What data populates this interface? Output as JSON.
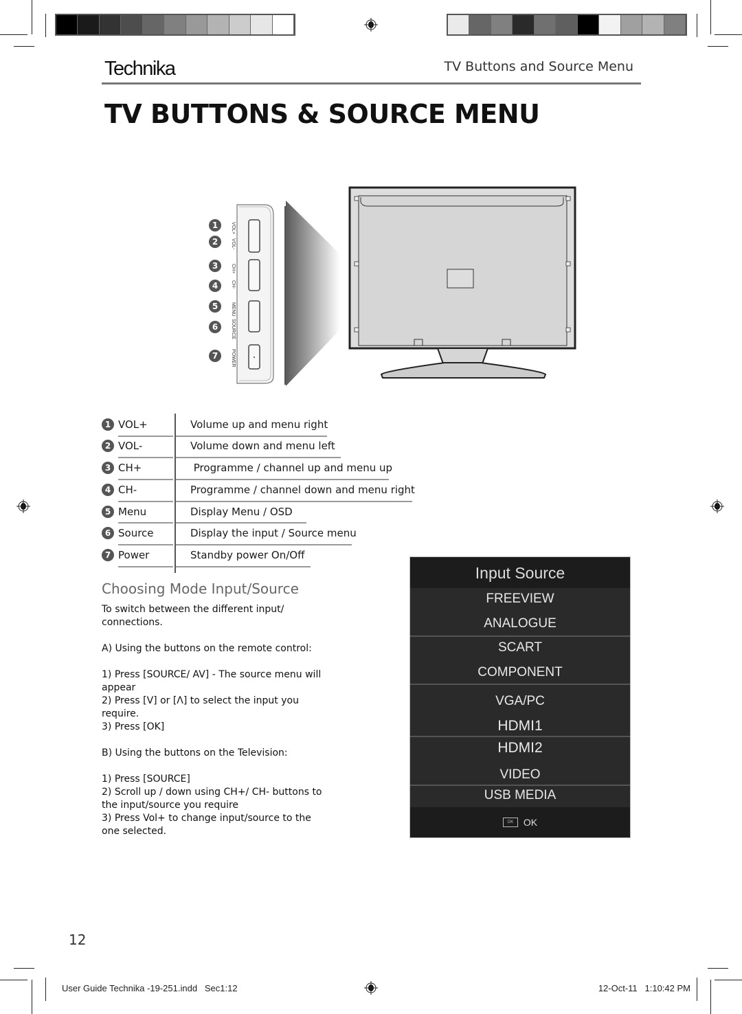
{
  "header": {
    "brand": "Technika",
    "section_title": "TV Buttons and Source Menu",
    "page_title": "TV BUTTONS & SOURCE MENU"
  },
  "calibration": {
    "left_bar": [
      "#000000",
      "#1a1a1a",
      "#333333",
      "#4d4d4d",
      "#666666",
      "#808080",
      "#999999",
      "#b3b3b3",
      "#cccccc",
      "#e6e6e6",
      "#ffffff"
    ],
    "right_bar": [
      "#eaeaea",
      "#666666",
      "#808080",
      "#2a2a2a",
      "#707070",
      "#5f5f5f",
      "#000000",
      "#f2f2f2",
      "#a0a0a0",
      "#b3b3b3",
      "#808080"
    ]
  },
  "side_panel": {
    "numbers": [
      "1",
      "2",
      "3",
      "4",
      "5",
      "6",
      "7"
    ],
    "labels": [
      "VOL+",
      "VOL-",
      "CH+",
      "CH-",
      "MENU",
      "SOURCE",
      "POWER"
    ]
  },
  "buttons_table": [
    {
      "num": "1",
      "key": "VOL+",
      "description": "Volume up and menu right"
    },
    {
      "num": "2",
      "key": "VOL-",
      "description": "Volume down and menu left"
    },
    {
      "num": "3",
      "key": "CH+",
      "description": " Programme / channel up and menu up"
    },
    {
      "num": "4",
      "key": "CH-",
      "description": "Programme / channel down and menu right"
    },
    {
      "num": "5",
      "key": "Menu",
      "description": "Display Menu / OSD"
    },
    {
      "num": "6",
      "key": "Source",
      "description": "Display the input / Source menu"
    },
    {
      "num": "7",
      "key": "Power",
      "description": "Standby power On/Off"
    }
  ],
  "choosing": {
    "heading": "Choosing Mode Input/Source",
    "intro_1": "To switch between the different input/",
    "intro_2": "connections.",
    "a_heading": "A) Using the buttons on the remote control:",
    "a_step1_1": "1) Press [SOURCE/ AV] - The source menu will",
    "a_step1_2": "appear",
    "a_step2_1": "2) Press [V] or [Λ] to select the input you",
    "a_step2_2": "require.",
    "a_step3": "3) Press [OK]",
    "b_heading": "B) Using the buttons on the Television:",
    "b_step1": "1) Press [SOURCE]",
    "b_step2_1": "2) Scroll up / down using CH+/ CH- buttons to",
    "b_step2_2": "the input/source you require",
    "b_step3_1": "3) Press Vol+ to change input/source to the",
    "b_step3_2": "one selected."
  },
  "input_source_menu": {
    "title": "Input Source",
    "items": [
      "FREEVIEW",
      "ANALOGUE",
      "SCART",
      "COMPONENT",
      "VGA/PC",
      "HDMI1",
      "HDMI2",
      "VIDEO",
      "USB MEDIA"
    ],
    "ok_key_label": "OK",
    "ok_label": "OK"
  },
  "page_number": "12",
  "footer": {
    "file_info": "User Guide Technika -19-251.indd   Sec1:12",
    "timestamp": "12-Oct-11   1:10:42 PM"
  }
}
